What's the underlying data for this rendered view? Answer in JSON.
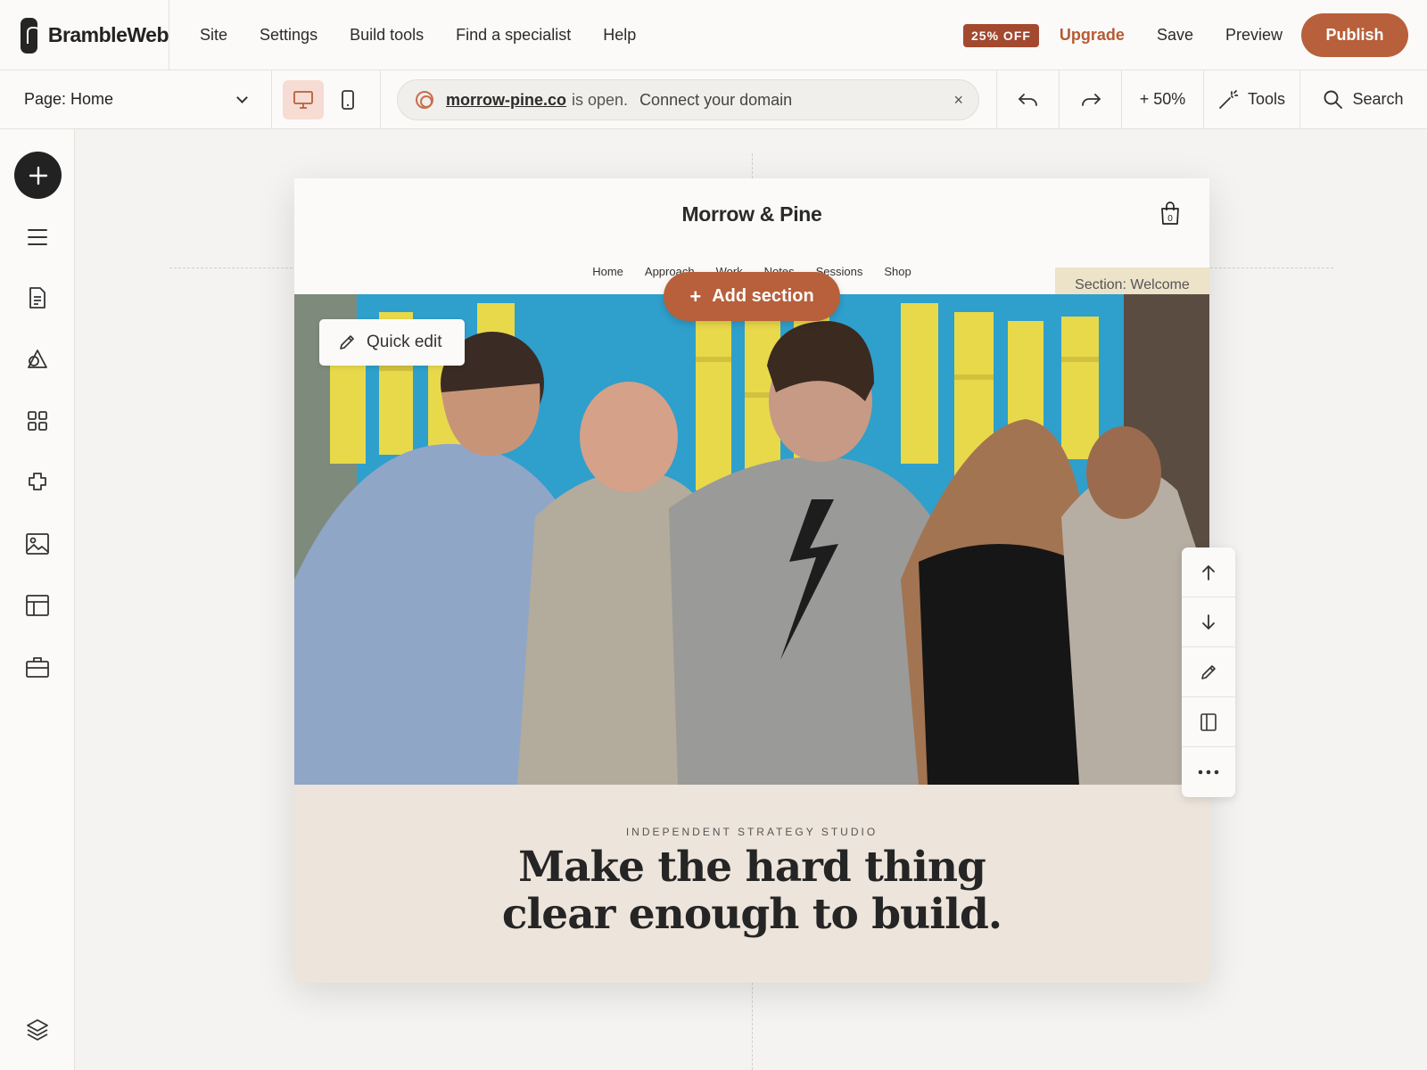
{
  "app": {
    "brand": "BrambleWeb",
    "nav": [
      "Site",
      "Settings",
      "Build tools",
      "Find a specialist",
      "Help"
    ],
    "promo_badge": "25% OFF",
    "upgrade_label": "Upgrade",
    "save_label": "Save",
    "preview_label": "Preview",
    "publish_label": "Publish",
    "accent_color": "#b7603b"
  },
  "toolbar": {
    "page_select": "Page: Home",
    "domain_name": "morrow-pine.co",
    "domain_status": "is open.",
    "domain_cta": "Connect your domain",
    "domain_close": "×",
    "zoom_label": "+ 50%",
    "tools_label": "Tools",
    "search_label": "Search"
  },
  "rail": {
    "icons": [
      "menu-icon",
      "page-icon",
      "design-icon",
      "blocks-icon",
      "plugins-icon",
      "media-icon",
      "table-icon",
      "briefcase-icon",
      "layers-icon"
    ]
  },
  "site": {
    "title": "Morrow & Pine",
    "cart_count": "0",
    "nav": [
      "Home",
      "Approach",
      "Work",
      "Notes",
      "Sessions",
      "Shop"
    ],
    "section_label": "Section: Welcome",
    "eyebrow": "INDEPENDENT STRATEGY STUDIO",
    "headline_line1": "Make the hard thing",
    "headline_line2": "clear enough to build."
  },
  "canvas": {
    "add_section_label": "Add section",
    "quick_edit_label": "Quick edit",
    "section_tools": [
      "move-up-icon",
      "move-down-icon",
      "edit-icon",
      "layout-icon",
      "more-icon"
    ]
  }
}
